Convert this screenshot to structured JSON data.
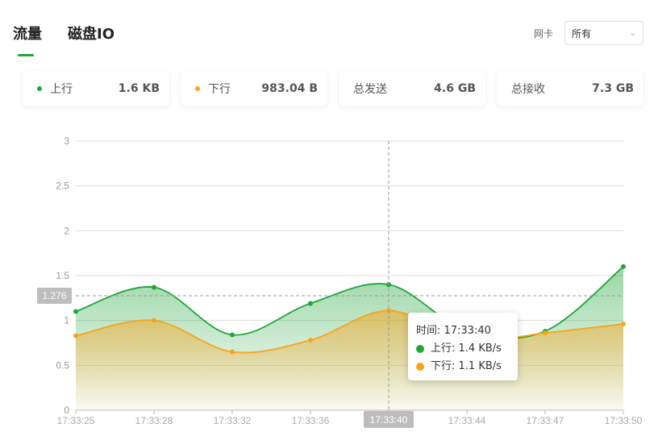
{
  "tabs": [
    {
      "label": "流量"
    },
    {
      "label": "磁盘IO"
    }
  ],
  "nic": {
    "label": "网卡",
    "selected": "所有"
  },
  "cards": [
    {
      "label": "上行",
      "value": "1.6 KB",
      "dot": "#20a53a"
    },
    {
      "label": "下行",
      "value": "983.04 B",
      "dot": "#f7a41c"
    },
    {
      "label": "总发送",
      "value": "4.6 GB"
    },
    {
      "label": "总接收",
      "value": "7.3 GB"
    }
  ],
  "chart_data": {
    "type": "area",
    "x": [
      "17:33:25",
      "17:33:28",
      "17:33:32",
      "17:33:36",
      "17:33:40",
      "17:33:44",
      "17:33:47",
      "17:33:50"
    ],
    "ylim": [
      0,
      3
    ],
    "yticks": [
      "0",
      "0.5",
      "1",
      "1.5",
      "2",
      "2.5",
      "3"
    ],
    "series": [
      {
        "name": "上行",
        "color": "#20a53a",
        "values": [
          1.1,
          1.37,
          0.84,
          1.19,
          1.4,
          0.88,
          0.88,
          1.6
        ]
      },
      {
        "name": "下行",
        "color": "#f7a41c",
        "values": [
          0.83,
          1.0,
          0.65,
          0.78,
          1.11,
          0.78,
          0.86,
          0.96
        ]
      }
    ],
    "crosshair": {
      "x": "17:33:40",
      "y_label": "1.276"
    },
    "tooltip": {
      "time_label": "时间: 17:33:40",
      "up": "上行: 1.4 KB/s",
      "down": "下行: 1.1 KB/s"
    }
  }
}
